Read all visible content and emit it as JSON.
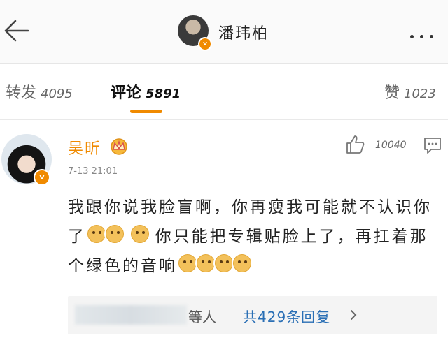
{
  "header": {
    "title": "潘玮柏",
    "badge": "v"
  },
  "tabs": {
    "forward": {
      "label": "转发",
      "count": "4095"
    },
    "comment": {
      "label": "评论",
      "count": "5891"
    },
    "like": {
      "label": "赞",
      "count": "1023"
    }
  },
  "comment": {
    "username": "吴昕",
    "badge": "v",
    "time": "7-13 21:01",
    "like_count": "10040",
    "text_part1": "我跟你说我脸盲啊，你再瘦我可能就不认识你了",
    "text_part2": " 你只能把专辑贴脸上了，再扛着那个绿色的音响",
    "replies": {
      "tail_text": "等人",
      "link_text": "共429条回复"
    }
  },
  "icons": {
    "back": "arrow-left-icon",
    "more": "more-dots-icon",
    "crown": "crown-icon",
    "like": "thumbs-up-icon",
    "reply": "comment-bubble-icon",
    "chevron": "chevron-right-icon",
    "emoji": "doge-emoji"
  },
  "colors": {
    "accent": "#f08a00",
    "link": "#2a6fb5"
  }
}
